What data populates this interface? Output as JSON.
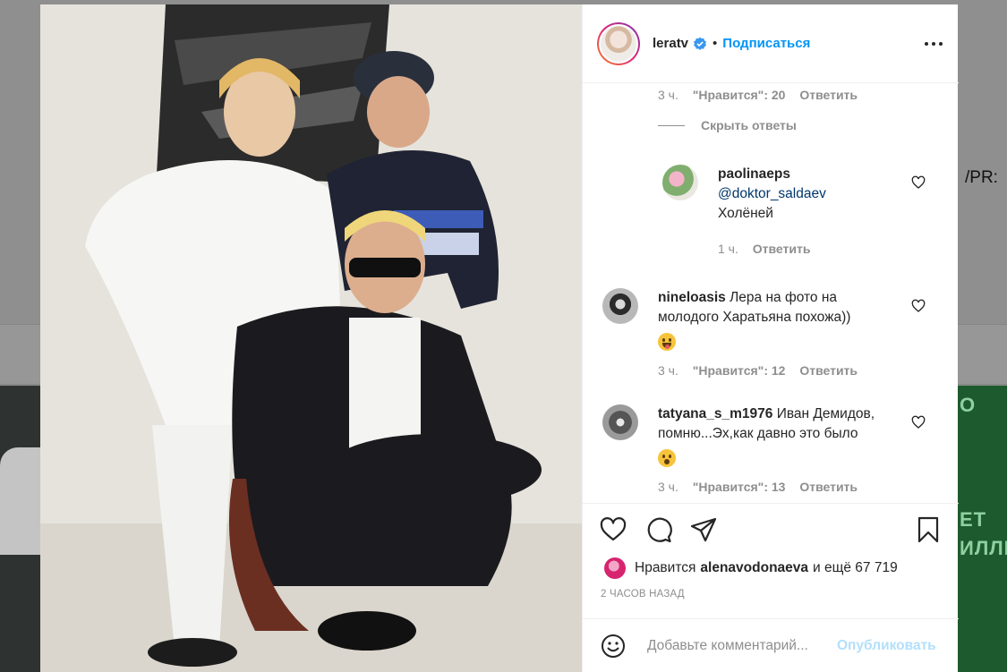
{
  "post": {
    "username": "leratv",
    "follow_label": "Подписаться",
    "separator": "•"
  },
  "comments": {
    "prev_meta": {
      "time": "3 ч.",
      "likes": "\"Нравится\": 20",
      "reply": "Ответить"
    },
    "hide_replies_label": "Скрыть ответы",
    "items": [
      {
        "username": "paolinaeps",
        "mention": "@doktor_saldaev",
        "text": "Холёней",
        "time": "1 ч.",
        "reply": "Ответить"
      },
      {
        "username": "nineloasis",
        "text": "Лера на фото на молодого Харатьяна похожа))",
        "emoji": "tongue-out-emoji",
        "time": "3 ч.",
        "likes": "\"Нравится\": 12",
        "reply": "Ответить"
      },
      {
        "username": "tatyana_s_m1976",
        "text": "Иван Демидов, помню...Эх,как давно это было",
        "emoji": "surprised-emoji",
        "time": "3 ч.",
        "likes": "\"Нравится\": 13",
        "reply": "Ответить"
      }
    ]
  },
  "likes": {
    "prefix": "Нравится",
    "user": "alenavodonaeva",
    "suffix": "и ещё 67 719"
  },
  "posted_ago": "2 ЧАСОВ НАЗАД",
  "add_comment": {
    "placeholder": "Добавьте комментарий...",
    "publish_label": "Опубликовать"
  },
  "background": {
    "side_text": "/PR:",
    "green_text_1": "О",
    "green_text_2": "ЕТ",
    "green_text_3": "ИЛЛИ"
  },
  "colors": {
    "accent": "#0095f6",
    "text": "#262626",
    "muted": "#8e8e8e",
    "publish_disabled": "#b2dffc"
  }
}
